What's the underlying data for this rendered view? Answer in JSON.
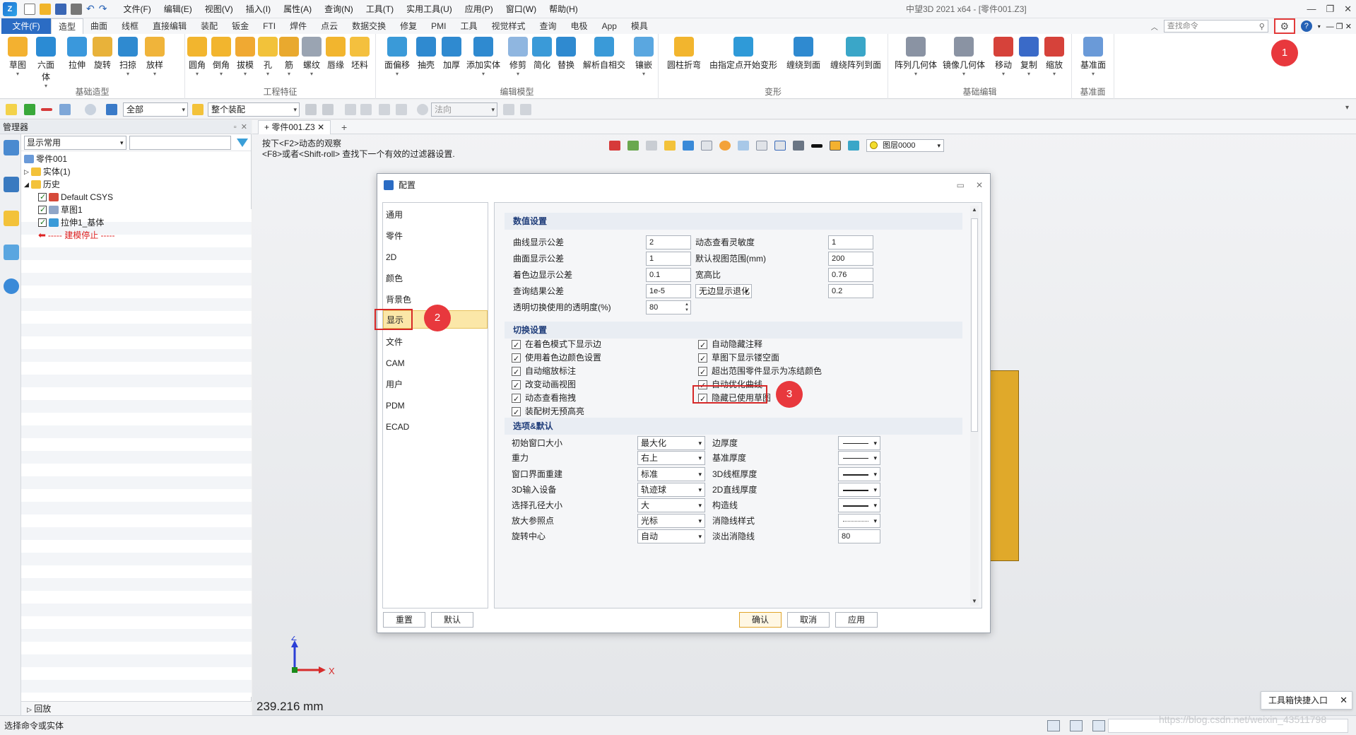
{
  "title_bar": {
    "menus": [
      "文件(F)",
      "编辑(E)",
      "视图(V)",
      "插入(I)",
      "属性(A)",
      "查询(N)",
      "工具(T)",
      "实用工具(U)",
      "应用(P)",
      "窗口(W)",
      "帮助(H)"
    ],
    "window_title": "中望3D 2021 x64 - [零件001.Z3]"
  },
  "ribbon_tabs": {
    "file": "文件(F)",
    "tabs": [
      "造型",
      "曲面",
      "线框",
      "直接编辑",
      "装配",
      "钣金",
      "FTI",
      "焊件",
      "点云",
      "数据交换",
      "修复",
      "PMI",
      "工具",
      "视觉样式",
      "查询",
      "电极",
      "App",
      "模具"
    ],
    "active": "造型",
    "search_placeholder": "查找命令"
  },
  "ribbon": {
    "groups": [
      {
        "label": "基础造型",
        "buttons": [
          "草图",
          "六面体",
          "拉伸",
          "旋转",
          "扫掠",
          "放样"
        ]
      },
      {
        "label": "工程特征",
        "buttons": [
          "圆角",
          "倒角",
          "拔模",
          "孔",
          "筋",
          "螺纹",
          "唇缘",
          "坯料"
        ]
      },
      {
        "label": "编辑模型",
        "buttons": [
          "面偏移",
          "抽壳",
          "加厚",
          "添加实体",
          "修剪",
          "简化",
          "替换",
          "解析自相交",
          "镶嵌"
        ]
      },
      {
        "label": "变形",
        "buttons": [
          "圆柱折弯",
          "由指定点开始变形",
          "缠绕到面",
          "缠绕阵列到面"
        ]
      },
      {
        "label": "基础编辑",
        "buttons": [
          "阵列几何体",
          "镜像几何体",
          "移动",
          "复制",
          "缩放"
        ]
      },
      {
        "label": "基准面",
        "buttons": [
          "基准面"
        ]
      }
    ]
  },
  "toolbar2": {
    "filter_value": "全部",
    "scope_value": "整个装配",
    "normal_value": "法向"
  },
  "manager": {
    "title": "管理器",
    "filter_value": "显示常用",
    "tree": {
      "root": "零件001",
      "solid": "实体(1)",
      "history": "历史",
      "items": [
        "Default CSYS",
        "草图1",
        "拉伸1_基体"
      ],
      "stop_marker": "----- 建模停止 -----"
    },
    "rollback": "回放"
  },
  "graphics": {
    "doc_tab": "零件001.Z3",
    "hint_line1": "按下<F2>动态的观察",
    "hint_line2": "<F8>或者<Shift-roll> 查找下一个有效的过滤器设置.",
    "layer": "图层0000",
    "measure": "239.216 mm",
    "axis_z": "Z",
    "axis_x": "X"
  },
  "dialog": {
    "title": "配置",
    "categories": [
      "通用",
      "零件",
      "2D",
      "颜色",
      "背景色",
      "显示",
      "文件",
      "CAM",
      "用户",
      "PDM",
      "ECAD"
    ],
    "selected_category": "显示",
    "numeric_section": "数值设置",
    "numeric_rows": [
      {
        "label": "曲线显示公差",
        "value": "2",
        "label2": "动态查看灵敏度",
        "value2": "1"
      },
      {
        "label": "曲面显示公差",
        "value": "1",
        "label2": "默认视图范围(mm)",
        "value2": "200"
      },
      {
        "label": "着色边显示公差",
        "value": "0.1",
        "label2": "宽高比",
        "value2": "0.76"
      },
      {
        "label": "查询结果公差",
        "value": "1e-5",
        "label2": "无边显示退化",
        "value2": "0.2"
      }
    ],
    "transparency_label": "透明切换使用的透明度(%)",
    "transparency_value": "80",
    "toggle_section": "切换设置",
    "toggles_left": [
      "在着色模式下显示边",
      "使用着色边颜色设置",
      "自动缩放标注",
      "改变动画视图",
      "动态查看拖拽",
      "装配树无预高亮"
    ],
    "toggles_right": [
      "自动隐藏注释",
      "草图下显示镂空面",
      "超出范围零件显示为冻结颜色",
      "自动优化曲线",
      "隐藏已使用草图"
    ],
    "options_section": "选项&默认",
    "options": [
      {
        "label": "初始窗口大小",
        "value": "最大化",
        "label2": "边厚度"
      },
      {
        "label": "重力",
        "value": "右上",
        "label2": "基准厚度"
      },
      {
        "label": "窗口界面重建",
        "value": "标准",
        "label2": "3D线框厚度"
      },
      {
        "label": "3D输入设备",
        "value": "轨迹球",
        "label2": "2D直线厚度"
      },
      {
        "label": "选择孔径大小",
        "value": "大",
        "label2": "构造线"
      },
      {
        "label": "放大参照点",
        "value": "光标",
        "label2": "消隐线样式"
      },
      {
        "label": "旋转中心",
        "value": "自动",
        "label2": "淡出消隐线",
        "value2": "80"
      }
    ],
    "buttons": {
      "reset": "重置",
      "default": "默认",
      "ok": "确认",
      "cancel": "取消",
      "apply": "应用"
    }
  },
  "annotations": {
    "badge1": "1",
    "badge2": "2",
    "badge3": "3"
  },
  "status_bar": {
    "text": "选择命令或实体",
    "quick_entry": "工具箱快捷入口",
    "watermark": "https://blog.csdn.net/weixin_43511798"
  },
  "colors": {
    "accent": "#2b6cc4",
    "highlight": "#e8383d",
    "selection": "#fbe7a8",
    "part": "#e0a92a"
  }
}
